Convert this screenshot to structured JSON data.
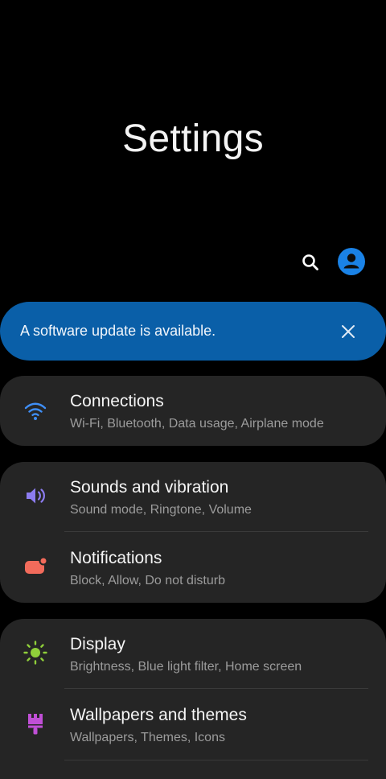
{
  "header": {
    "title": "Settings"
  },
  "toolbar": {
    "search_icon": "search-icon",
    "account_icon": "account-icon"
  },
  "banner": {
    "text": "A software update is available.",
    "close_icon": "close-icon",
    "color": "#0a5fa8"
  },
  "menu": {
    "items": [
      {
        "title": "Connections",
        "subtitle": "Wi-Fi, Bluetooth, Data usage, Airplane mode",
        "icon": "wifi-icon",
        "icon_color": "#3f8ef5"
      },
      {
        "title": "Sounds and vibration",
        "subtitle": "Sound mode, Ringtone, Volume",
        "icon": "speaker-icon",
        "icon_color": "#8c7cf0"
      },
      {
        "title": "Notifications",
        "subtitle": "Block, Allow, Do not disturb",
        "icon": "notification-icon",
        "icon_color": "#f26b5b"
      },
      {
        "title": "Display",
        "subtitle": "Brightness, Blue light filter, Home screen",
        "icon": "brightness-icon",
        "icon_color": "#8fcf3a"
      },
      {
        "title": "Wallpapers and themes",
        "subtitle": "Wallpapers, Themes, Icons",
        "icon": "brush-icon",
        "icon_color": "#c04fd6"
      }
    ]
  }
}
